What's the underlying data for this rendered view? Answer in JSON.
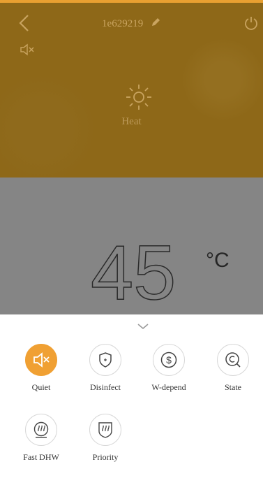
{
  "header": {
    "device_name": "1e629219",
    "mode": "Heat"
  },
  "temperature": {
    "value": "45",
    "unit": "°C"
  },
  "functions": [
    {
      "label": "Quiet",
      "icon": "mute-icon",
      "active": true
    },
    {
      "label": "Disinfect",
      "icon": "shield-icon",
      "active": false
    },
    {
      "label": "W-depend",
      "icon": "dollar-icon",
      "active": false
    },
    {
      "label": "State",
      "icon": "state-icon",
      "active": false
    },
    {
      "label": "Fast DHW",
      "icon": "fast-dhw-icon",
      "active": false
    },
    {
      "label": "Priority",
      "icon": "priority-icon",
      "active": false
    }
  ],
  "colors": {
    "accent": "#f0a033",
    "header_bg": "#8e6818",
    "temp_bg": "#858585"
  }
}
